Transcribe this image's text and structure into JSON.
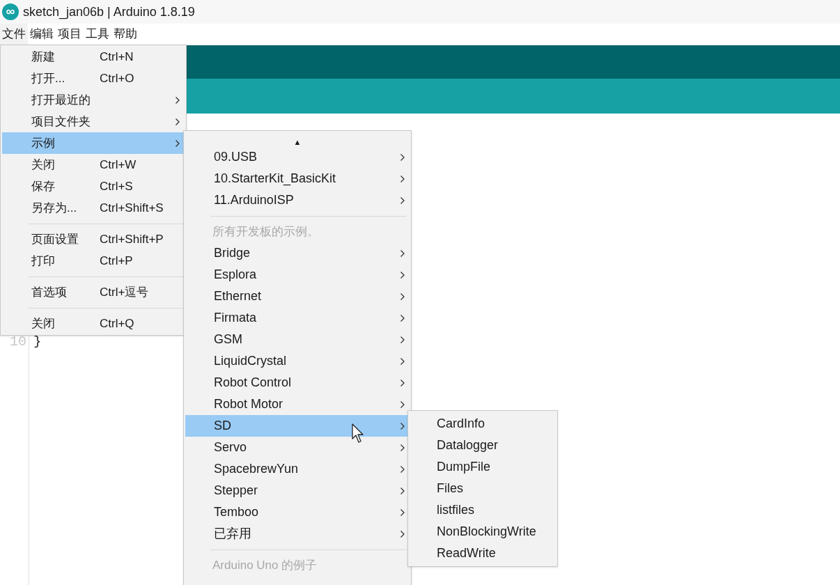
{
  "window": {
    "title": "sketch_jan06b | Arduino 1.8.19"
  },
  "menubar": [
    {
      "label": "文件",
      "selected": true
    },
    {
      "label": "编辑",
      "selected": false
    },
    {
      "label": "项目",
      "selected": false
    },
    {
      "label": "工具",
      "selected": false
    },
    {
      "label": "帮助",
      "selected": false
    }
  ],
  "editor": {
    "line_number": "10",
    "code": "}"
  },
  "file_menu": {
    "items": [
      {
        "kind": "item",
        "label": "新建",
        "shortcut": "Ctrl+N",
        "selected": false,
        "submenu": false
      },
      {
        "kind": "item",
        "label": "打开...",
        "shortcut": "Ctrl+O",
        "selected": false,
        "submenu": false
      },
      {
        "kind": "item",
        "label": "打开最近的",
        "selected": false,
        "submenu": true
      },
      {
        "kind": "item",
        "label": "项目文件夹",
        "selected": false,
        "submenu": true
      },
      {
        "kind": "item",
        "label": "示例",
        "selected": true,
        "submenu": true
      },
      {
        "kind": "item",
        "label": "关闭",
        "shortcut": "Ctrl+W",
        "selected": false,
        "submenu": false
      },
      {
        "kind": "item",
        "label": "保存",
        "shortcut": "Ctrl+S",
        "selected": false,
        "submenu": false
      },
      {
        "kind": "item",
        "label": "另存为...",
        "shortcut": "Ctrl+Shift+S",
        "selected": false,
        "submenu": false
      },
      {
        "kind": "separator"
      },
      {
        "kind": "item",
        "label": "页面设置",
        "shortcut": "Ctrl+Shift+P",
        "selected": false,
        "submenu": false
      },
      {
        "kind": "item",
        "label": "打印",
        "shortcut": "Ctrl+P",
        "selected": false,
        "submenu": false
      },
      {
        "kind": "separator"
      },
      {
        "kind": "item",
        "label": "首选项",
        "shortcut": "Ctrl+逗号",
        "selected": false,
        "submenu": false
      },
      {
        "kind": "separator"
      },
      {
        "kind": "item",
        "label": "关闭",
        "shortcut": "Ctrl+Q",
        "selected": false,
        "submenu": false
      }
    ]
  },
  "examples_menu": {
    "scroll_up": "▲",
    "items": [
      {
        "kind": "item",
        "label": "09.USB",
        "selected": false
      },
      {
        "kind": "item",
        "label": "10.StarterKit_BasicKit",
        "selected": false
      },
      {
        "kind": "item",
        "label": "11.ArduinoISP",
        "selected": false
      },
      {
        "kind": "separator"
      },
      {
        "kind": "header",
        "label": "所有开发板的示例。"
      },
      {
        "kind": "item",
        "label": "Bridge",
        "selected": false
      },
      {
        "kind": "item",
        "label": "Esplora",
        "selected": false
      },
      {
        "kind": "item",
        "label": "Ethernet",
        "selected": false
      },
      {
        "kind": "item",
        "label": "Firmata",
        "selected": false
      },
      {
        "kind": "item",
        "label": "GSM",
        "selected": false
      },
      {
        "kind": "item",
        "label": "LiquidCrystal",
        "selected": false
      },
      {
        "kind": "item",
        "label": "Robot Control",
        "selected": false
      },
      {
        "kind": "item",
        "label": "Robot Motor",
        "selected": false
      },
      {
        "kind": "item",
        "label": "SD",
        "selected": true
      },
      {
        "kind": "item",
        "label": "Servo",
        "selected": false
      },
      {
        "kind": "item",
        "label": "SpacebrewYun",
        "selected": false
      },
      {
        "kind": "item",
        "label": "Stepper",
        "selected": false
      },
      {
        "kind": "item",
        "label": "Temboo",
        "selected": false
      },
      {
        "kind": "item",
        "label": "已弃用",
        "selected": false
      },
      {
        "kind": "separator"
      },
      {
        "kind": "header",
        "label": "Arduino Uno 的例子"
      }
    ]
  },
  "sd_menu": {
    "items": [
      {
        "label": "CardInfo"
      },
      {
        "label": "Datalogger"
      },
      {
        "label": "DumpFile"
      },
      {
        "label": "Files"
      },
      {
        "label": "listfiles"
      },
      {
        "label": "NonBlockingWrite"
      },
      {
        "label": "ReadWrite"
      }
    ]
  }
}
